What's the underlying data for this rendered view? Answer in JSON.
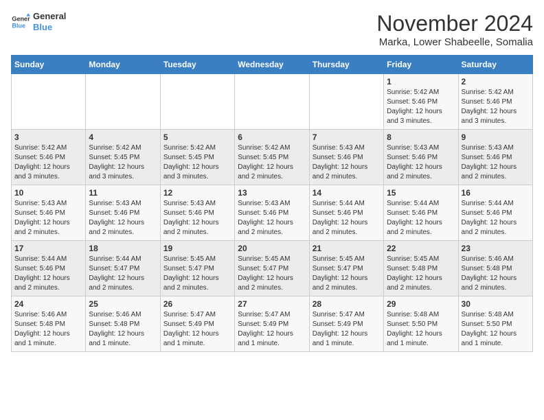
{
  "logo": {
    "line1": "General",
    "line2": "Blue"
  },
  "title": "November 2024",
  "subtitle": "Marka, Lower Shabeelle, Somalia",
  "days_of_week": [
    "Sunday",
    "Monday",
    "Tuesday",
    "Wednesday",
    "Thursday",
    "Friday",
    "Saturday"
  ],
  "weeks": [
    [
      {
        "day": "",
        "info": ""
      },
      {
        "day": "",
        "info": ""
      },
      {
        "day": "",
        "info": ""
      },
      {
        "day": "",
        "info": ""
      },
      {
        "day": "",
        "info": ""
      },
      {
        "day": "1",
        "info": "Sunrise: 5:42 AM\nSunset: 5:46 PM\nDaylight: 12 hours\nand 3 minutes."
      },
      {
        "day": "2",
        "info": "Sunrise: 5:42 AM\nSunset: 5:46 PM\nDaylight: 12 hours\nand 3 minutes."
      }
    ],
    [
      {
        "day": "3",
        "info": "Sunrise: 5:42 AM\nSunset: 5:46 PM\nDaylight: 12 hours\nand 3 minutes."
      },
      {
        "day": "4",
        "info": "Sunrise: 5:42 AM\nSunset: 5:45 PM\nDaylight: 12 hours\nand 3 minutes."
      },
      {
        "day": "5",
        "info": "Sunrise: 5:42 AM\nSunset: 5:45 PM\nDaylight: 12 hours\nand 3 minutes."
      },
      {
        "day": "6",
        "info": "Sunrise: 5:42 AM\nSunset: 5:45 PM\nDaylight: 12 hours\nand 2 minutes."
      },
      {
        "day": "7",
        "info": "Sunrise: 5:43 AM\nSunset: 5:46 PM\nDaylight: 12 hours\nand 2 minutes."
      },
      {
        "day": "8",
        "info": "Sunrise: 5:43 AM\nSunset: 5:46 PM\nDaylight: 12 hours\nand 2 minutes."
      },
      {
        "day": "9",
        "info": "Sunrise: 5:43 AM\nSunset: 5:46 PM\nDaylight: 12 hours\nand 2 minutes."
      }
    ],
    [
      {
        "day": "10",
        "info": "Sunrise: 5:43 AM\nSunset: 5:46 PM\nDaylight: 12 hours\nand 2 minutes."
      },
      {
        "day": "11",
        "info": "Sunrise: 5:43 AM\nSunset: 5:46 PM\nDaylight: 12 hours\nand 2 minutes."
      },
      {
        "day": "12",
        "info": "Sunrise: 5:43 AM\nSunset: 5:46 PM\nDaylight: 12 hours\nand 2 minutes."
      },
      {
        "day": "13",
        "info": "Sunrise: 5:43 AM\nSunset: 5:46 PM\nDaylight: 12 hours\nand 2 minutes."
      },
      {
        "day": "14",
        "info": "Sunrise: 5:44 AM\nSunset: 5:46 PM\nDaylight: 12 hours\nand 2 minutes."
      },
      {
        "day": "15",
        "info": "Sunrise: 5:44 AM\nSunset: 5:46 PM\nDaylight: 12 hours\nand 2 minutes."
      },
      {
        "day": "16",
        "info": "Sunrise: 5:44 AM\nSunset: 5:46 PM\nDaylight: 12 hours\nand 2 minutes."
      }
    ],
    [
      {
        "day": "17",
        "info": "Sunrise: 5:44 AM\nSunset: 5:46 PM\nDaylight: 12 hours\nand 2 minutes."
      },
      {
        "day": "18",
        "info": "Sunrise: 5:44 AM\nSunset: 5:47 PM\nDaylight: 12 hours\nand 2 minutes."
      },
      {
        "day": "19",
        "info": "Sunrise: 5:45 AM\nSunset: 5:47 PM\nDaylight: 12 hours\nand 2 minutes."
      },
      {
        "day": "20",
        "info": "Sunrise: 5:45 AM\nSunset: 5:47 PM\nDaylight: 12 hours\nand 2 minutes."
      },
      {
        "day": "21",
        "info": "Sunrise: 5:45 AM\nSunset: 5:47 PM\nDaylight: 12 hours\nand 2 minutes."
      },
      {
        "day": "22",
        "info": "Sunrise: 5:45 AM\nSunset: 5:48 PM\nDaylight: 12 hours\nand 2 minutes."
      },
      {
        "day": "23",
        "info": "Sunrise: 5:46 AM\nSunset: 5:48 PM\nDaylight: 12 hours\nand 2 minutes."
      }
    ],
    [
      {
        "day": "24",
        "info": "Sunrise: 5:46 AM\nSunset: 5:48 PM\nDaylight: 12 hours\nand 1 minute."
      },
      {
        "day": "25",
        "info": "Sunrise: 5:46 AM\nSunset: 5:48 PM\nDaylight: 12 hours\nand 1 minute."
      },
      {
        "day": "26",
        "info": "Sunrise: 5:47 AM\nSunset: 5:49 PM\nDaylight: 12 hours\nand 1 minute."
      },
      {
        "day": "27",
        "info": "Sunrise: 5:47 AM\nSunset: 5:49 PM\nDaylight: 12 hours\nand 1 minute."
      },
      {
        "day": "28",
        "info": "Sunrise: 5:47 AM\nSunset: 5:49 PM\nDaylight: 12 hours\nand 1 minute."
      },
      {
        "day": "29",
        "info": "Sunrise: 5:48 AM\nSunset: 5:50 PM\nDaylight: 12 hours\nand 1 minute."
      },
      {
        "day": "30",
        "info": "Sunrise: 5:48 AM\nSunset: 5:50 PM\nDaylight: 12 hours\nand 1 minute."
      }
    ]
  ]
}
